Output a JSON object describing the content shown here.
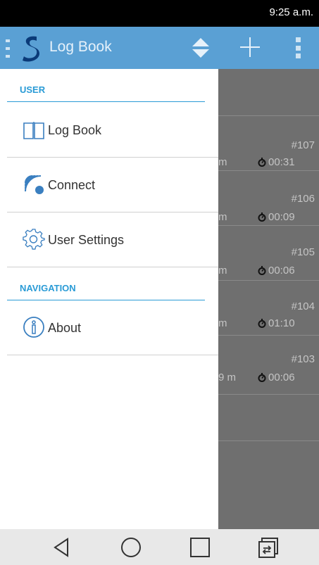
{
  "status_bar": {
    "time": "9:25 a.m."
  },
  "app_bar": {
    "title": "Log Book",
    "accent_color": "#5aa0d4"
  },
  "drawer": {
    "sections": [
      {
        "header": "USER",
        "items": [
          {
            "label": "Log Book",
            "icon": "book-icon"
          },
          {
            "label": "Connect",
            "icon": "wireless-connect-icon"
          },
          {
            "label": "User Settings",
            "icon": "gear-icon"
          }
        ]
      },
      {
        "header": "NAVIGATION",
        "items": [
          {
            "label": "About",
            "icon": "info-icon"
          }
        ]
      }
    ],
    "accent_color": "#2a9bd6"
  },
  "background_list": {
    "items": [
      {
        "number": "#107",
        "distance": "m",
        "duration": "00:31"
      },
      {
        "number": "#106",
        "distance": "m",
        "duration": "00:09"
      },
      {
        "number": "#105",
        "distance": "m",
        "duration": "00:06"
      },
      {
        "number": "#104",
        "distance": "m",
        "duration": "01:10"
      },
      {
        "number": "#103",
        "distance": "9 m",
        "duration": "00:06"
      }
    ]
  },
  "nav_bar": {
    "buttons": [
      "back-icon",
      "home-icon",
      "recents-icon",
      "switch-icon"
    ]
  }
}
